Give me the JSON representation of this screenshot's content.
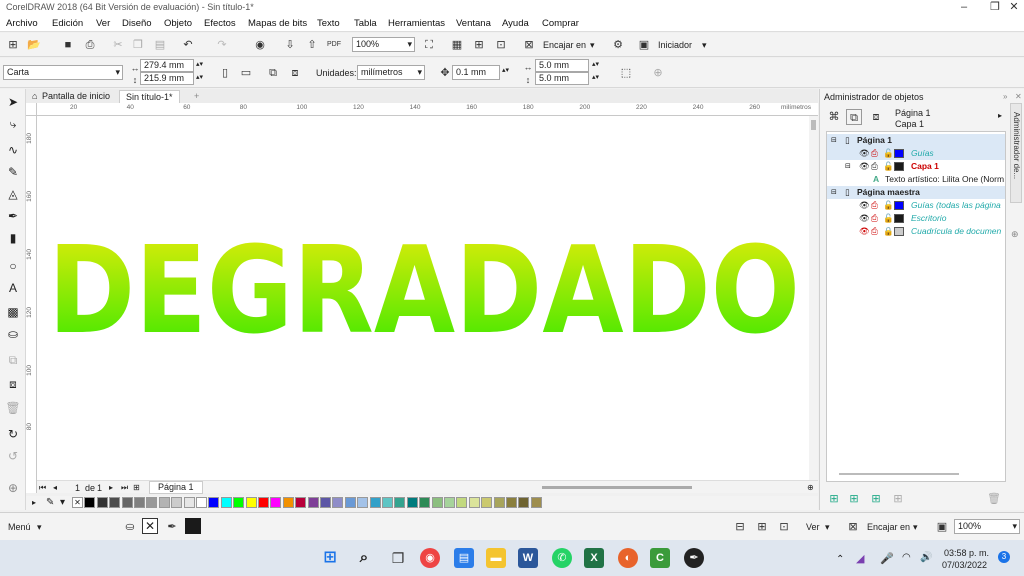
{
  "window": {
    "title": "CorelDRAW 2018 (64 Bit Versión de evaluación) - Sin título-1*"
  },
  "menu": [
    "Archivo",
    "Edición",
    "Ver",
    "Diseño",
    "Objeto",
    "Efectos",
    "Mapas de bits",
    "Texto",
    "Tabla",
    "Herramientas",
    "Ventana",
    "Ayuda",
    "Comprar"
  ],
  "toolbar": {
    "zoom": "100%",
    "snap": "Encajar en",
    "workspace": "Iniciador"
  },
  "propertybar": {
    "paper": "Carta",
    "width": "279.4 mm",
    "height": "215.9 mm",
    "units_label": "Unidades:",
    "units": "milímetros",
    "nudge": "0.1 mm",
    "dup_x": "5.0 mm",
    "dup_y": "5.0 mm"
  },
  "doctabs": {
    "home": "Pantalla de inicio",
    "doc": "Sin título-1*"
  },
  "ruler": {
    "h_ticks": [
      "20",
      "40",
      "60",
      "80",
      "100",
      "120",
      "140",
      "160",
      "180",
      "200",
      "220",
      "240",
      "260"
    ],
    "unit": "milímetros",
    "v_ticks": [
      "180",
      "160",
      "140",
      "120",
      "100",
      "80"
    ]
  },
  "canvas": {
    "text": "DEGRADADO",
    "gradient_top": "#e9ec0a",
    "gradient_bottom": "#32e800"
  },
  "page_nav": {
    "current": "1",
    "of": "de",
    "total": "1",
    "page_tab": "Página 1"
  },
  "palette_colors": [
    "#ffffff",
    "#000000",
    "#333333",
    "#4d4d4d",
    "#666666",
    "#808080",
    "#999999",
    "#b3b3b3",
    "#cccccc",
    "#e6e6e6",
    "#ffffff",
    "#0000ff",
    "#00ffff",
    "#00ff00",
    "#ffff00",
    "#ff0000",
    "#ff00ff",
    "#f29100",
    "#b8003a",
    "#7f3f98",
    "#5d57a6",
    "#8f8dc8",
    "#6a9ad6",
    "#a3c2e8",
    "#33a1c9",
    "#5fc5c4",
    "#34a38f",
    "#007b7d",
    "#2e8b57",
    "#8cbf7f",
    "#a6d39b",
    "#c2d97f",
    "#dbe49b",
    "#cbc96f",
    "#a8a55c",
    "#8a7f3d",
    "#6f6431",
    "#9e8e4e"
  ],
  "docker": {
    "title": "Administrador de objetos",
    "vtab": "Administrador de...",
    "page": "Página 1",
    "layer": "Capa 1",
    "rows": [
      {
        "text": "Página 1",
        "color": ""
      },
      {
        "text": "Guías",
        "color": "#0000ff"
      },
      {
        "text": "Capa 1",
        "color": "#1a1a1a"
      },
      {
        "text": "Texto artístico: Lilita One (Norm",
        "color": ""
      },
      {
        "text": "Página maestra",
        "color": ""
      },
      {
        "text": "Guías (todas las página",
        "color": "#0000ff"
      },
      {
        "text": "Escritorio",
        "color": "#1a1a1a"
      },
      {
        "text": "Cuadrícula de documen",
        "color": "#cccccc"
      }
    ]
  },
  "status": {
    "menu": "Menú",
    "view": "Ver",
    "snap": "Encajar en",
    "zoom": "100%"
  },
  "taskbar": {
    "time": "03:58 p. m.",
    "date": "07/03/2022",
    "badge": "3"
  }
}
